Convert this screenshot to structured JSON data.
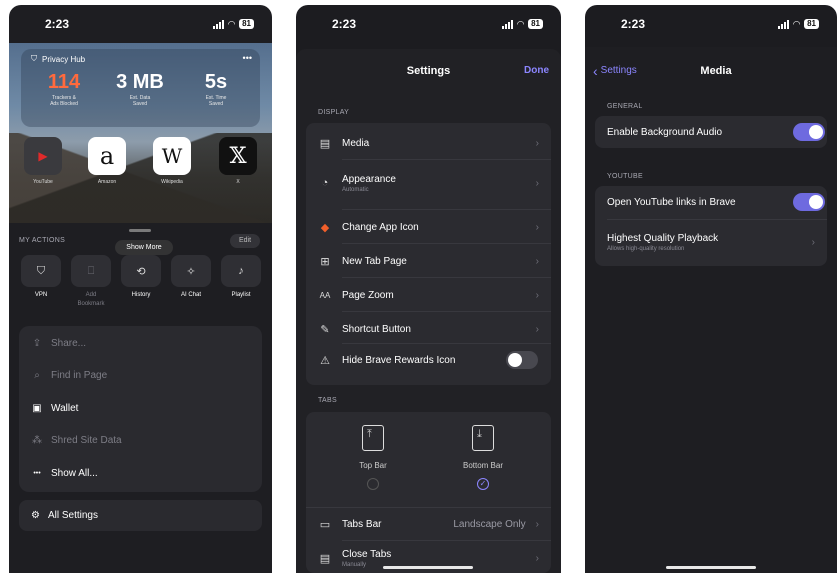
{
  "panels": [
    {
      "time": "2:23",
      "battery": "81",
      "privacy_hub": {
        "title": "Privacy Hub",
        "more": "•••",
        "stats": [
          {
            "value": "114",
            "label": "Trackers &\nAds Blocked",
            "color": "#ff6a3d"
          },
          {
            "value": "3 MB",
            "label": "Est. Data\nSaved",
            "color": "#ffffff"
          },
          {
            "value": "5s",
            "label": "Est. Time\nSaved",
            "color": "#ffffff"
          }
        ]
      },
      "favorites": [
        {
          "label": "YouTube",
          "glyph": "▶",
          "icon": "youtube-icon"
        },
        {
          "label": "Amazon",
          "glyph": "a",
          "icon": "amazon-icon"
        },
        {
          "label": "Wikipedia",
          "glyph": "W",
          "icon": "wikipedia-icon"
        },
        {
          "label": "X",
          "glyph": "𝕏",
          "icon": "x-icon"
        }
      ],
      "show_more": "Show More",
      "my_actions_title": "MY ACTIONS",
      "edit": "Edit",
      "actions": [
        {
          "label": "VPN",
          "glyph": "⛉",
          "icon": "vpn-shield-icon",
          "dim": false
        },
        {
          "label": "Add\nBookmark",
          "glyph": "⎕",
          "icon": "bookmark-icon",
          "dim": true
        },
        {
          "label": "History",
          "glyph": "⟲",
          "icon": "history-icon",
          "dim": false
        },
        {
          "label": "AI Chat",
          "glyph": "✧",
          "icon": "ai-chat-icon",
          "dim": false
        },
        {
          "label": "Playlist",
          "glyph": "♪",
          "icon": "playlist-icon",
          "dim": false
        }
      ],
      "menu": [
        {
          "label": "Share...",
          "glyph": "⇪",
          "icon": "share-icon",
          "dim": true
        },
        {
          "label": "Find in Page",
          "glyph": "⌕",
          "icon": "search-icon",
          "dim": true
        },
        {
          "label": "Wallet",
          "glyph": "▣",
          "icon": "wallet-icon",
          "dim": false
        },
        {
          "label": "Shred Site Data",
          "glyph": "⁂",
          "icon": "shred-icon",
          "dim": true
        },
        {
          "label": "Show All...",
          "glyph": "•••",
          "icon": "more-icon",
          "dim": false
        }
      ],
      "all_settings": "All Settings"
    },
    {
      "time": "2:23",
      "battery": "81",
      "title": "Settings",
      "done": "Done",
      "display_header": "DISPLAY",
      "display_rows": [
        {
          "label": "Media",
          "sub": "",
          "glyph": "▤",
          "icon": "media-icon"
        },
        {
          "label": "Appearance",
          "sub": "Automatic",
          "glyph": "◔",
          "icon": "appearance-icon"
        },
        {
          "label": "Change App Icon",
          "sub": "",
          "glyph": "◆",
          "icon": "brave-icon"
        },
        {
          "label": "New Tab Page",
          "sub": "",
          "glyph": "⊞",
          "icon": "new-tab-icon"
        },
        {
          "label": "Page Zoom",
          "sub": "",
          "glyph": "AA",
          "icon": "zoom-icon"
        },
        {
          "label": "Shortcut Button",
          "sub": "",
          "glyph": "✎",
          "icon": "shortcut-icon"
        }
      ],
      "hide_rewards": {
        "label": "Hide Brave Rewards Icon",
        "glyph": "⚠",
        "on": false
      },
      "tabs_header": "TABS",
      "tab_bar_options": [
        {
          "label": "Top Bar",
          "selected": false
        },
        {
          "label": "Bottom Bar",
          "selected": true
        }
      ],
      "tabs_bar": {
        "label": "Tabs Bar",
        "value": "Landscape Only"
      },
      "close_tabs": {
        "label": "Close Tabs",
        "sub": "Manually"
      }
    },
    {
      "time": "2:23",
      "battery": "81",
      "back": "Settings",
      "title": "Media",
      "general_header": "GENERAL",
      "background_audio": {
        "label": "Enable Background Audio",
        "on": true
      },
      "youtube_header": "YOUTUBE",
      "open_youtube": {
        "label": "Open YouTube links in Brave",
        "on": true
      },
      "hq_playback": {
        "label": "Highest Quality Playback",
        "sub": "Allows high-quality resolution"
      }
    }
  ],
  "colors": {
    "accent": "#8c86ff",
    "toggle_on": "#6e6adf",
    "toggle_off": "#48484f",
    "tracker": "#ff6a3d",
    "youtube": "#e02a2a"
  }
}
